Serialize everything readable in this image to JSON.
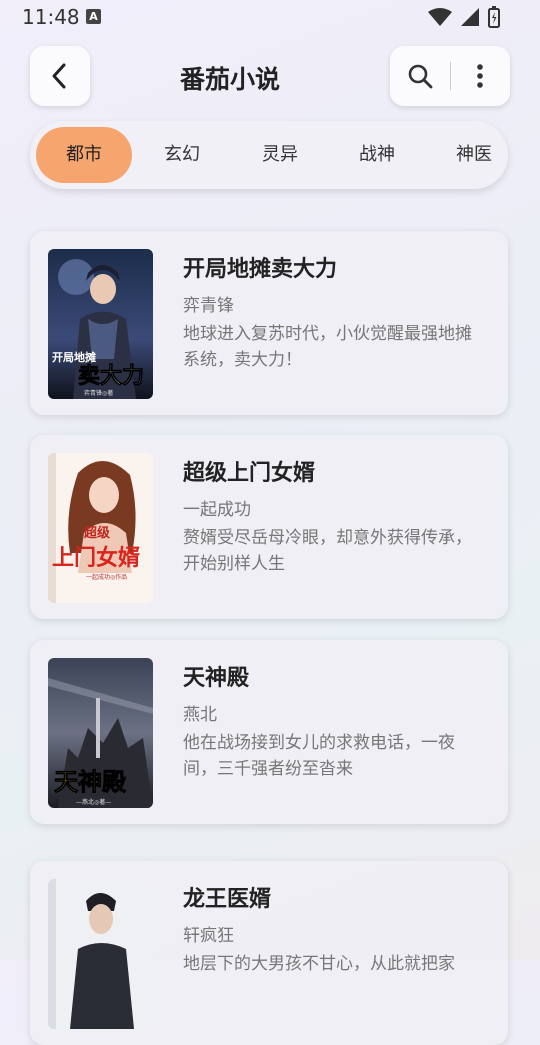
{
  "status": {
    "time": "11:48",
    "notif_badge": "A"
  },
  "header": {
    "title": "番茄小说"
  },
  "tabs": [
    "都市",
    "玄幻",
    "灵异",
    "战神",
    "神医"
  ],
  "books": [
    {
      "title": "开局地摊卖大力",
      "author": "弈青锋",
      "desc": "地球进入复苏时代，小伙觉醒最强地摊系统，卖大力！",
      "cover_text": "卖大力",
      "cover_small": "开局地摊",
      "cover_byline": "弈青锋◎著"
    },
    {
      "title": "超级上门女婿",
      "author": "一起成功",
      "desc": "赘婿受尽岳母冷眼，却意外获得传承，开始别样人生",
      "cover_text": "上门女婿",
      "cover_small": "超级",
      "cover_byline": "一起成功◎作品"
    },
    {
      "title": "天神殿",
      "author": "燕北",
      "desc": "他在战场接到女儿的求救电话，一夜间，三千强者纷至沓来",
      "cover_text": "天神殿",
      "cover_small": "",
      "cover_byline": "—燕北◎著—"
    },
    {
      "title": "龙王医婿",
      "author": "轩疯狂",
      "desc": "地层下的大男孩不甘心，从此就把家",
      "cover_text": "",
      "cover_small": "",
      "cover_byline": ""
    }
  ],
  "colors": {
    "tab_active": "#f7a56f",
    "text_primary": "#222222",
    "text_secondary": "#777777"
  }
}
